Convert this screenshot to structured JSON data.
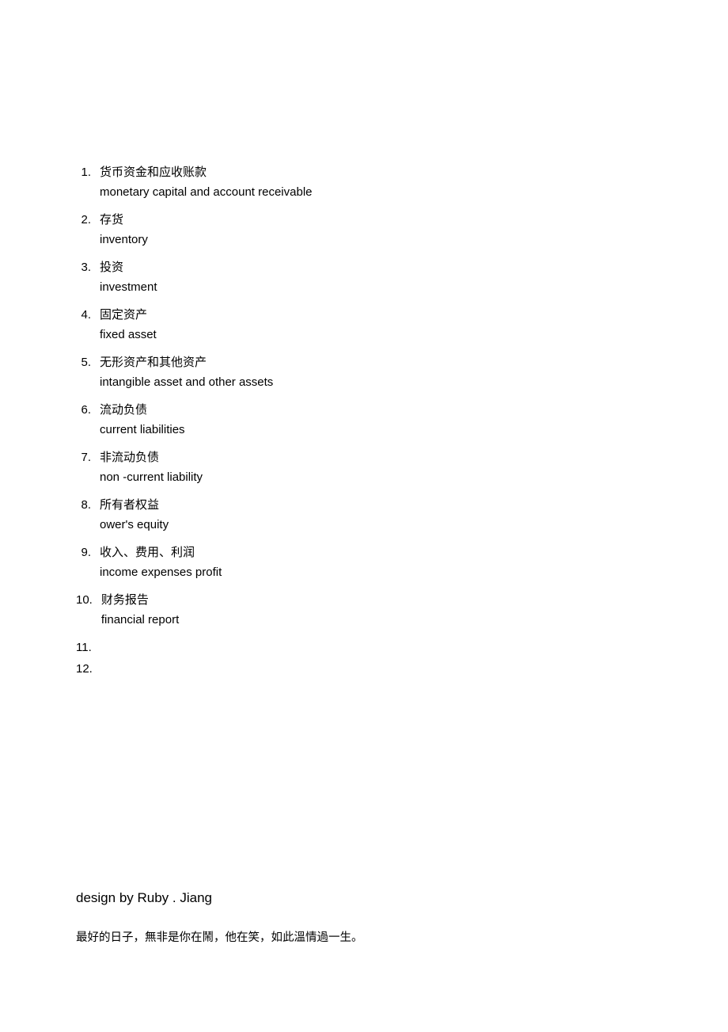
{
  "list": {
    "items": [
      {
        "num": "1.",
        "cn": "货币资金和应收账款",
        "en": "monetary capital and account receivable"
      },
      {
        "num": "2.",
        "cn": "存货",
        "en": "inventory"
      },
      {
        "num": "3.",
        "cn": "投资",
        "en": "investment"
      },
      {
        "num": "4.",
        "cn": "固定资产",
        "en": "fixed asset"
      },
      {
        "num": "5.",
        "cn": "无形资产和其他资产",
        "en": "intangible asset    and other assets"
      },
      {
        "num": "6.",
        "cn": "流动负债",
        "en": "current liabilities"
      },
      {
        "num": "7.",
        "cn": "非流动负债",
        "en": "non -current liability"
      },
      {
        "num": "8.",
        "cn": "所有者权益",
        "en": "ower's equity"
      },
      {
        "num": "9.",
        "cn": "收入、费用、利润",
        "en": "income   expenses  profit"
      },
      {
        "num": "10.",
        "cn": "财务报告",
        "en": "financial report"
      },
      {
        "num": "11.",
        "cn": "",
        "en": ""
      },
      {
        "num": "12.",
        "cn": "",
        "en": ""
      }
    ]
  },
  "footer": {
    "designer": "design by Ruby . Jiang",
    "quote": "最好的日子，無非是你在鬧，他在笑，如此溫情過一生。"
  }
}
